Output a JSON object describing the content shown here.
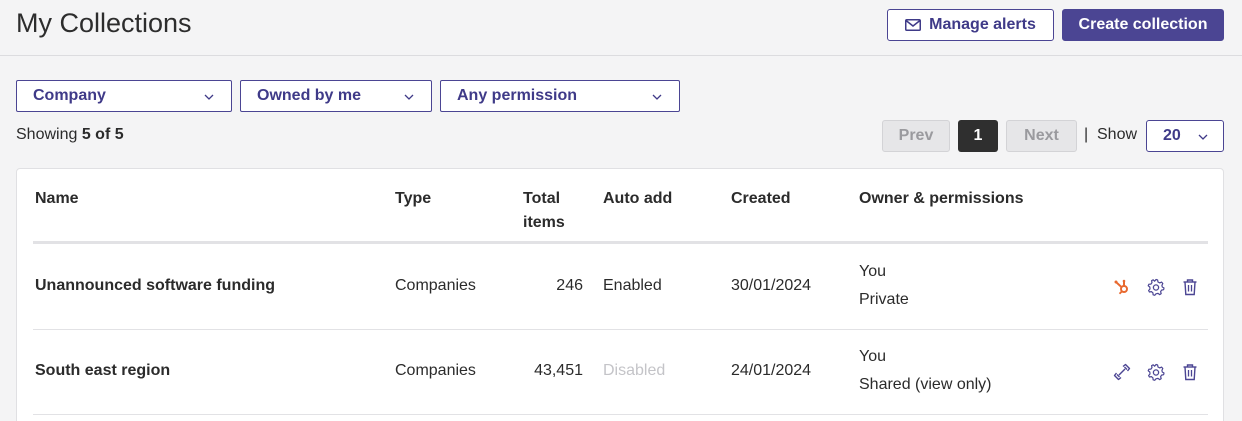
{
  "header": {
    "title": "My Collections",
    "manage_alerts_label": "Manage alerts",
    "create_collection_label": "Create collection"
  },
  "filters": {
    "company": "Company",
    "owner": "Owned by me",
    "permission": "Any permission"
  },
  "summary": {
    "prefix": "Showing ",
    "count": "5 of 5"
  },
  "pagination": {
    "prev_label": "Prev",
    "current_page": "1",
    "next_label": "Next",
    "separator": "|",
    "show_label": "Show",
    "page_size": "20"
  },
  "table": {
    "columns": {
      "name": "Name",
      "type": "Type",
      "total_line1": "Total",
      "total_line2": "items",
      "auto_add": "Auto add",
      "created": "Created",
      "owner_permissions": "Owner & permissions"
    },
    "rows": [
      {
        "name": "Unannounced software funding",
        "type": "Companies",
        "total": "246",
        "auto_add": "Enabled",
        "created": "30/01/2024",
        "owner": "You",
        "permission": "Private",
        "sync_icon": "hubspot-icon"
      },
      {
        "name": "South east region",
        "type": "Companies",
        "total": "43,451",
        "auto_add": "Disabled",
        "created": "24/01/2024",
        "owner": "You",
        "permission": "Shared (view only)",
        "sync_icon": "link-icon"
      }
    ]
  },
  "colors": {
    "accent": "#4b4593",
    "hubspot": "#e8692f",
    "muted": "#c4c4c8"
  }
}
